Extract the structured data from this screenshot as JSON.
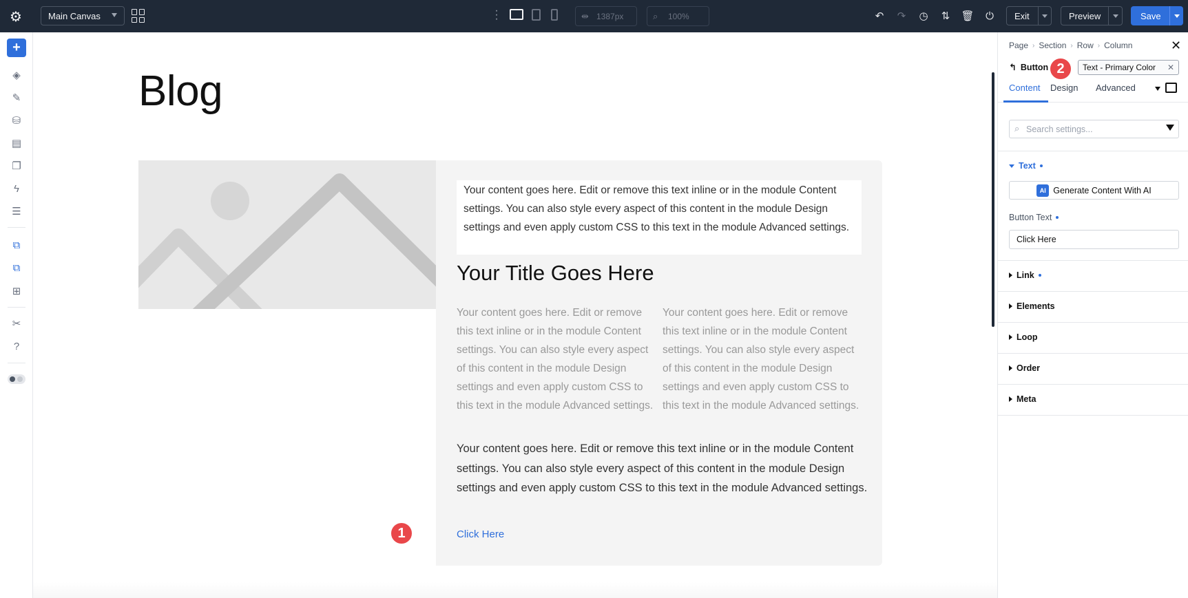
{
  "topbar": {
    "canvas_select": "Main Canvas",
    "width_value": "1387px",
    "zoom_value": "100%",
    "exit_label": "Exit",
    "preview_label": "Preview",
    "save_label": "Save"
  },
  "canvas": {
    "page_title": "Blog",
    "box_text": "Your content goes here. Edit or remove this text inline or in the module Content settings. You can also style every aspect of this content in the module Design settings and even apply custom CSS to this text in the module Advanced settings.",
    "post_title": "Your Title Goes Here",
    "col1_text": "Your content goes here. Edit or remove this text inline or in the module Content settings. You can also style every aspect of this content in the module Design settings and even apply custom CSS to this text in the module Advanced settings.",
    "col2_text": "Your content goes here. Edit or remove this text inline or in the module Content settings. You can also style every aspect of this content in the module Design settings and even apply custom CSS to this text in the module Advanced settings.",
    "para_text": "Your content goes here. Edit or remove this text inline or in the module Content settings. You can also style every aspect of this content in the module Design settings and even apply custom CSS to this text in the module Advanced settings.",
    "button_text": "Click Here",
    "badge1": "1",
    "badge2": "2"
  },
  "panel": {
    "breadcrumbs": [
      "Page",
      "Section",
      "Row",
      "Column"
    ],
    "module_name": "Button",
    "preset_chip": "Text - Primary Color",
    "tabs": [
      "Content",
      "Design",
      "Advanced"
    ],
    "search_placeholder": "Search settings...",
    "text_group": "Text",
    "ai_button": "Generate Content With AI",
    "ai_badge": "AI",
    "button_text_label": "Button Text",
    "button_text_value": "Click Here",
    "groups": [
      "Link",
      "Elements",
      "Loop",
      "Order",
      "Meta"
    ]
  },
  "colors": {
    "accent": "#2f6fdb",
    "topbar": "#1f2937",
    "badge": "#e9474a"
  }
}
